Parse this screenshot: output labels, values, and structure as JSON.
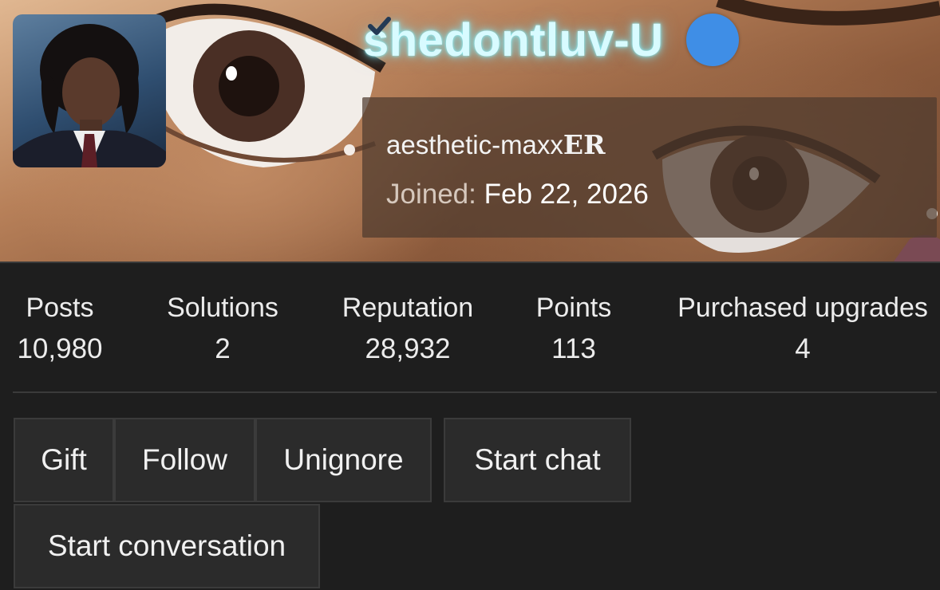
{
  "profile": {
    "username": "shedontluv-U",
    "title_part1": "aesthetic-maxx",
    "title_part2": "ER",
    "joined_label": "Joined:",
    "joined_date": "Feb 22, 2026",
    "verified_icon": "verified-check-icon",
    "username_glow_color": "#d8fbff",
    "verified_color": "#3f8ee6"
  },
  "stats": [
    {
      "label": "Posts",
      "value": "10,980"
    },
    {
      "label": "Solutions",
      "value": "2"
    },
    {
      "label": "Reputation",
      "value": "28,932"
    },
    {
      "label": "Points",
      "value": "113"
    },
    {
      "label": "Purchased upgrades",
      "value": "4"
    }
  ],
  "actions": {
    "gift": "Gift",
    "follow": "Follow",
    "unignore": "Unignore",
    "start_chat": "Start chat",
    "start_conversation": "Start conversation"
  }
}
